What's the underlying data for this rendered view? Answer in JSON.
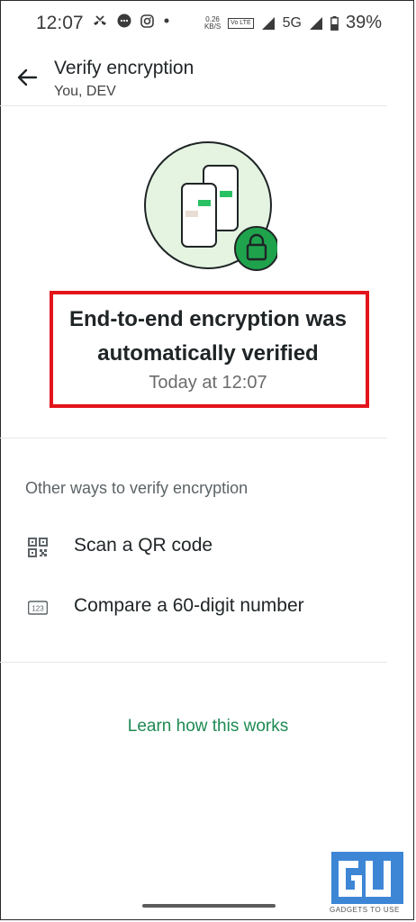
{
  "status_bar": {
    "time": "12:07",
    "net_speed_value": "0.26",
    "net_speed_unit": "KB/S",
    "volte": "Vo LTE",
    "network": "5G",
    "battery": "39%"
  },
  "app_bar": {
    "title": "Verify encryption",
    "subtitle": "You, DEV"
  },
  "main": {
    "headline_line1": "End-to-end encryption was",
    "headline_line2": "automatically verified",
    "verified_time": "Today at 12:07"
  },
  "other_ways": {
    "label": "Other ways to verify encryption",
    "options": [
      {
        "label": "Scan a QR code",
        "icon": "qr-code-icon"
      },
      {
        "label": "Compare a 60-digit number",
        "icon": "number-123-icon"
      }
    ]
  },
  "learn_link": "Learn how this works",
  "watermark": {
    "text": "GADGETS TO USE"
  },
  "colors": {
    "accent_green": "#1e8a53",
    "highlight_red": "#e3141b",
    "illustration_bg": "#e4f4e1",
    "lock_green": "#1ea34c"
  }
}
